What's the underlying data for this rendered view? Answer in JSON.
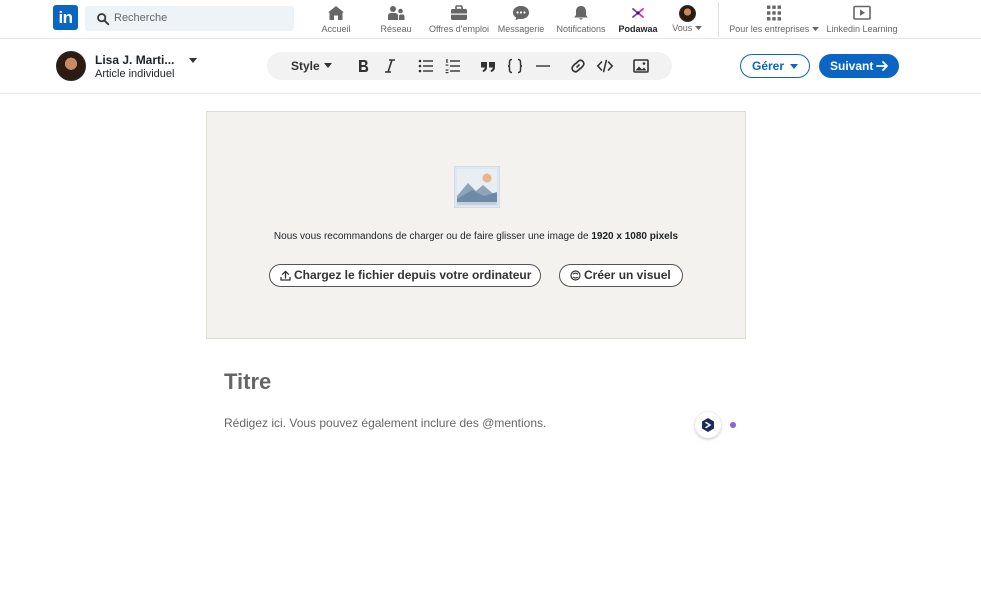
{
  "nav": {
    "logo_text": "in",
    "search_placeholder": "Recherche",
    "items": [
      {
        "label": "Accueil",
        "icon": "home-icon"
      },
      {
        "label": "Réseau",
        "icon": "network-icon"
      },
      {
        "label": "Offres d'emploi",
        "icon": "briefcase-icon"
      },
      {
        "label": "Messagerie",
        "icon": "messaging-icon"
      },
      {
        "label": "Notifications",
        "icon": "bell-icon"
      },
      {
        "label": "Podawaa",
        "icon": "podawaa-icon"
      },
      {
        "label": "Vous",
        "icon": "avatar"
      },
      {
        "label": "Pour les entreprises",
        "icon": "grid-icon"
      },
      {
        "label": "Linkedin Learning",
        "icon": "learning-icon"
      }
    ]
  },
  "author": {
    "name": "Lisa J. Marti...",
    "subtitle": "Article individuel"
  },
  "toolbar": {
    "style_label": "Style",
    "buttons": [
      "bold-icon",
      "italic-icon",
      "bullet-list-icon",
      "numbered-list-icon",
      "quote-icon",
      "code-block-icon",
      "divider-icon",
      "link-icon",
      "embed-icon",
      "image-icon"
    ]
  },
  "actions": {
    "manage_label": "Gérer",
    "next_label": "Suivant"
  },
  "cover": {
    "text_prefix": "Nous vous recommandons de charger ou de faire glisser une image de",
    "text_bold": "1920 x 1080 pixels",
    "upload_label": "Chargez le fichier depuis votre ordinateur",
    "visual_label": "Créer un visuel"
  },
  "editor": {
    "title_placeholder": "Titre",
    "body_placeholder": "Rédigez ici. Vous pouvez également inclure des @mentions."
  },
  "colors": {
    "brand": "#0a66c2",
    "cover_bg": "#f3f2ee",
    "assist_dot": "#8a63d2"
  }
}
